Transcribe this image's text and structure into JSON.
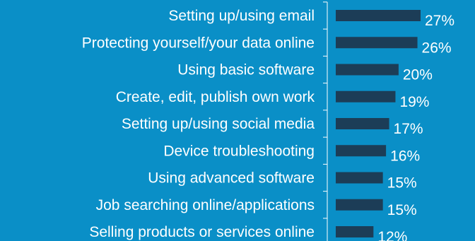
{
  "chart_data": {
    "type": "bar",
    "orientation": "horizontal",
    "categories": [
      "Setting up/using email",
      "Protecting yourself/your data online",
      "Using basic software",
      "Create, edit, publish own work",
      "Setting up/using social media",
      "Device troubleshooting",
      "Using advanced software",
      "Job searching online/applications",
      "Selling products or services online"
    ],
    "values": [
      27,
      26,
      20,
      19,
      17,
      16,
      15,
      15,
      12
    ],
    "value_labels": [
      "27%",
      "26%",
      "20%",
      "19%",
      "17%",
      "16%",
      "15%",
      "15%",
      "12%"
    ],
    "unit": "%",
    "title": "",
    "xlabel": "",
    "ylabel": "",
    "grid": false,
    "legend": "none",
    "colors": {
      "background": "#0a8fc7",
      "bar": "#1c3d57",
      "text": "#ffffff",
      "axis": "#ffffff"
    }
  }
}
